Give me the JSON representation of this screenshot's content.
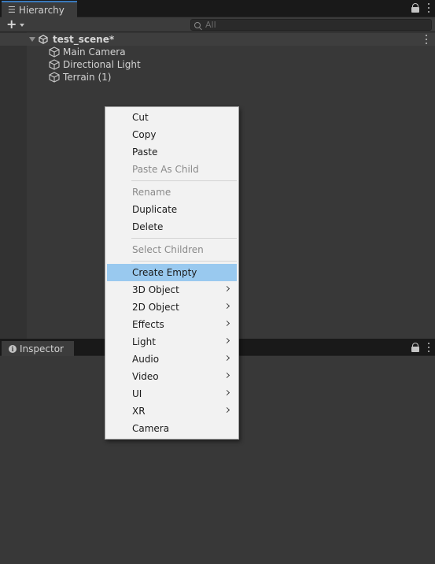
{
  "hierarchy": {
    "tab_label": "Hierarchy",
    "search_placeholder": "All",
    "scene": {
      "name": "test_scene*",
      "objects": [
        {
          "label": "Main Camera"
        },
        {
          "label": "Directional Light"
        },
        {
          "label": "Terrain (1)"
        }
      ]
    }
  },
  "inspector": {
    "tab_label": "Inspector"
  },
  "context_menu": {
    "items": [
      {
        "label": "Cut",
        "enabled": true
      },
      {
        "label": "Copy",
        "enabled": true
      },
      {
        "label": "Paste",
        "enabled": true
      },
      {
        "label": "Paste As Child",
        "enabled": false
      },
      {
        "label": "Rename",
        "enabled": false
      },
      {
        "label": "Duplicate",
        "enabled": true
      },
      {
        "label": "Delete",
        "enabled": true
      },
      {
        "label": "Select Children",
        "enabled": false
      },
      {
        "label": "Create Empty",
        "enabled": true,
        "highlighted": true
      },
      {
        "label": "3D Object",
        "enabled": true,
        "submenu": true
      },
      {
        "label": "2D Object",
        "enabled": true,
        "submenu": true
      },
      {
        "label": "Effects",
        "enabled": true,
        "submenu": true
      },
      {
        "label": "Light",
        "enabled": true,
        "submenu": true
      },
      {
        "label": "Audio",
        "enabled": true,
        "submenu": true
      },
      {
        "label": "Video",
        "enabled": true,
        "submenu": true
      },
      {
        "label": "UI",
        "enabled": true,
        "submenu": true
      },
      {
        "label": "XR",
        "enabled": true,
        "submenu": true
      },
      {
        "label": "Camera",
        "enabled": true
      }
    ]
  },
  "colors": {
    "highlight": "#99c9ef",
    "tab_accent": "#3a79bb",
    "panel_bg": "#383838",
    "menu_bg": "#f2f2f2"
  }
}
